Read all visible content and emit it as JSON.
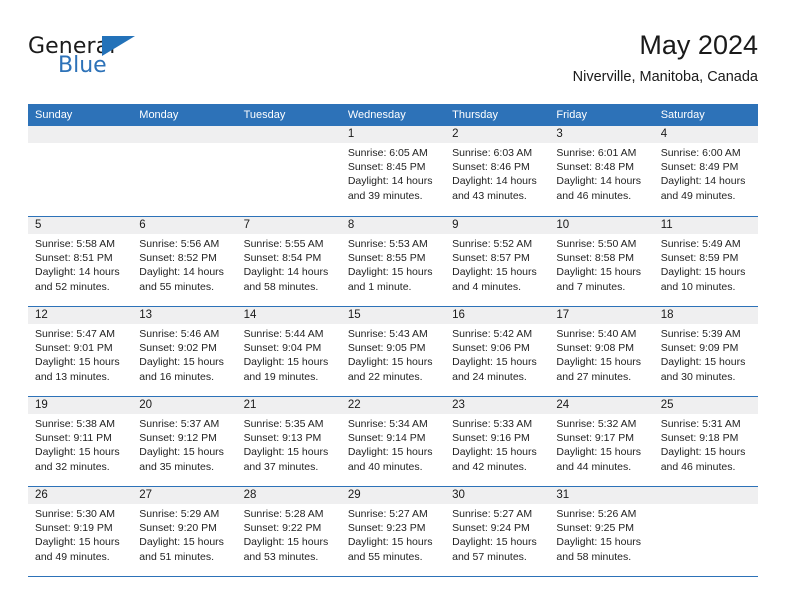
{
  "brand": {
    "name_top": "General",
    "name_bottom": "Blue",
    "flag_icon": "triangle-flag-icon",
    "accent_color": "#2372b9"
  },
  "header": {
    "title": "May 2024",
    "subtitle": "Niverville, Manitoba, Canada"
  },
  "colors": {
    "header_blue": "#2d72b8",
    "band_gray": "#efeff0",
    "text": "#1a1a1a"
  },
  "weekdays": [
    "Sunday",
    "Monday",
    "Tuesday",
    "Wednesday",
    "Thursday",
    "Friday",
    "Saturday"
  ],
  "weeks": [
    [
      {
        "empty": true,
        "date": "",
        "lines": []
      },
      {
        "empty": true,
        "date": "",
        "lines": []
      },
      {
        "empty": true,
        "date": "",
        "lines": []
      },
      {
        "empty": false,
        "date": "1",
        "lines": [
          "Sunrise: 6:05 AM",
          "Sunset: 8:45 PM",
          "Daylight: 14 hours",
          "and 39 minutes."
        ]
      },
      {
        "empty": false,
        "date": "2",
        "lines": [
          "Sunrise: 6:03 AM",
          "Sunset: 8:46 PM",
          "Daylight: 14 hours",
          "and 43 minutes."
        ]
      },
      {
        "empty": false,
        "date": "3",
        "lines": [
          "Sunrise: 6:01 AM",
          "Sunset: 8:48 PM",
          "Daylight: 14 hours",
          "and 46 minutes."
        ]
      },
      {
        "empty": false,
        "date": "4",
        "lines": [
          "Sunrise: 6:00 AM",
          "Sunset: 8:49 PM",
          "Daylight: 14 hours",
          "and 49 minutes."
        ]
      }
    ],
    [
      {
        "empty": false,
        "date": "5",
        "lines": [
          "Sunrise: 5:58 AM",
          "Sunset: 8:51 PM",
          "Daylight: 14 hours",
          "and 52 minutes."
        ]
      },
      {
        "empty": false,
        "date": "6",
        "lines": [
          "Sunrise: 5:56 AM",
          "Sunset: 8:52 PM",
          "Daylight: 14 hours",
          "and 55 minutes."
        ]
      },
      {
        "empty": false,
        "date": "7",
        "lines": [
          "Sunrise: 5:55 AM",
          "Sunset: 8:54 PM",
          "Daylight: 14 hours",
          "and 58 minutes."
        ]
      },
      {
        "empty": false,
        "date": "8",
        "lines": [
          "Sunrise: 5:53 AM",
          "Sunset: 8:55 PM",
          "Daylight: 15 hours",
          "and 1 minute."
        ]
      },
      {
        "empty": false,
        "date": "9",
        "lines": [
          "Sunrise: 5:52 AM",
          "Sunset: 8:57 PM",
          "Daylight: 15 hours",
          "and 4 minutes."
        ]
      },
      {
        "empty": false,
        "date": "10",
        "lines": [
          "Sunrise: 5:50 AM",
          "Sunset: 8:58 PM",
          "Daylight: 15 hours",
          "and 7 minutes."
        ]
      },
      {
        "empty": false,
        "date": "11",
        "lines": [
          "Sunrise: 5:49 AM",
          "Sunset: 8:59 PM",
          "Daylight: 15 hours",
          "and 10 minutes."
        ]
      }
    ],
    [
      {
        "empty": false,
        "date": "12",
        "lines": [
          "Sunrise: 5:47 AM",
          "Sunset: 9:01 PM",
          "Daylight: 15 hours",
          "and 13 minutes."
        ]
      },
      {
        "empty": false,
        "date": "13",
        "lines": [
          "Sunrise: 5:46 AM",
          "Sunset: 9:02 PM",
          "Daylight: 15 hours",
          "and 16 minutes."
        ]
      },
      {
        "empty": false,
        "date": "14",
        "lines": [
          "Sunrise: 5:44 AM",
          "Sunset: 9:04 PM",
          "Daylight: 15 hours",
          "and 19 minutes."
        ]
      },
      {
        "empty": false,
        "date": "15",
        "lines": [
          "Sunrise: 5:43 AM",
          "Sunset: 9:05 PM",
          "Daylight: 15 hours",
          "and 22 minutes."
        ]
      },
      {
        "empty": false,
        "date": "16",
        "lines": [
          "Sunrise: 5:42 AM",
          "Sunset: 9:06 PM",
          "Daylight: 15 hours",
          "and 24 minutes."
        ]
      },
      {
        "empty": false,
        "date": "17",
        "lines": [
          "Sunrise: 5:40 AM",
          "Sunset: 9:08 PM",
          "Daylight: 15 hours",
          "and 27 minutes."
        ]
      },
      {
        "empty": false,
        "date": "18",
        "lines": [
          "Sunrise: 5:39 AM",
          "Sunset: 9:09 PM",
          "Daylight: 15 hours",
          "and 30 minutes."
        ]
      }
    ],
    [
      {
        "empty": false,
        "date": "19",
        "lines": [
          "Sunrise: 5:38 AM",
          "Sunset: 9:11 PM",
          "Daylight: 15 hours",
          "and 32 minutes."
        ]
      },
      {
        "empty": false,
        "date": "20",
        "lines": [
          "Sunrise: 5:37 AM",
          "Sunset: 9:12 PM",
          "Daylight: 15 hours",
          "and 35 minutes."
        ]
      },
      {
        "empty": false,
        "date": "21",
        "lines": [
          "Sunrise: 5:35 AM",
          "Sunset: 9:13 PM",
          "Daylight: 15 hours",
          "and 37 minutes."
        ]
      },
      {
        "empty": false,
        "date": "22",
        "lines": [
          "Sunrise: 5:34 AM",
          "Sunset: 9:14 PM",
          "Daylight: 15 hours",
          "and 40 minutes."
        ]
      },
      {
        "empty": false,
        "date": "23",
        "lines": [
          "Sunrise: 5:33 AM",
          "Sunset: 9:16 PM",
          "Daylight: 15 hours",
          "and 42 minutes."
        ]
      },
      {
        "empty": false,
        "date": "24",
        "lines": [
          "Sunrise: 5:32 AM",
          "Sunset: 9:17 PM",
          "Daylight: 15 hours",
          "and 44 minutes."
        ]
      },
      {
        "empty": false,
        "date": "25",
        "lines": [
          "Sunrise: 5:31 AM",
          "Sunset: 9:18 PM",
          "Daylight: 15 hours",
          "and 46 minutes."
        ]
      }
    ],
    [
      {
        "empty": false,
        "date": "26",
        "lines": [
          "Sunrise: 5:30 AM",
          "Sunset: 9:19 PM",
          "Daylight: 15 hours",
          "and 49 minutes."
        ]
      },
      {
        "empty": false,
        "date": "27",
        "lines": [
          "Sunrise: 5:29 AM",
          "Sunset: 9:20 PM",
          "Daylight: 15 hours",
          "and 51 minutes."
        ]
      },
      {
        "empty": false,
        "date": "28",
        "lines": [
          "Sunrise: 5:28 AM",
          "Sunset: 9:22 PM",
          "Daylight: 15 hours",
          "and 53 minutes."
        ]
      },
      {
        "empty": false,
        "date": "29",
        "lines": [
          "Sunrise: 5:27 AM",
          "Sunset: 9:23 PM",
          "Daylight: 15 hours",
          "and 55 minutes."
        ]
      },
      {
        "empty": false,
        "date": "30",
        "lines": [
          "Sunrise: 5:27 AM",
          "Sunset: 9:24 PM",
          "Daylight: 15 hours",
          "and 57 minutes."
        ]
      },
      {
        "empty": false,
        "date": "31",
        "lines": [
          "Sunrise: 5:26 AM",
          "Sunset: 9:25 PM",
          "Daylight: 15 hours",
          "and 58 minutes."
        ]
      },
      {
        "empty": true,
        "date": "",
        "lines": []
      }
    ]
  ]
}
